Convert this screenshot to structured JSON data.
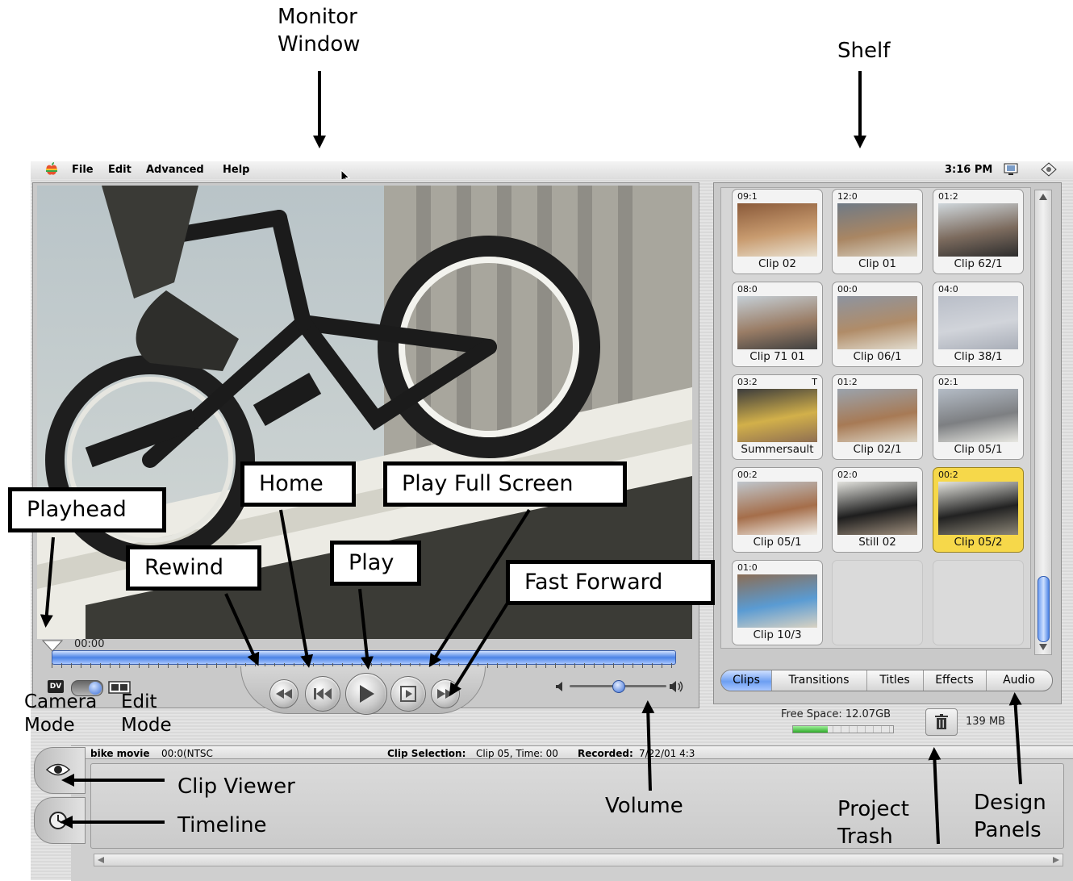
{
  "annotations": {
    "monitor_window": [
      "Monitor",
      "Window"
    ],
    "shelf": "Shelf",
    "playhead": "Playhead",
    "home": "Home",
    "play_full_screen": "Play Full Screen",
    "rewind": "Rewind",
    "play": "Play",
    "fast_forward": "Fast Forward",
    "camera_mode": [
      "Camera",
      "Mode"
    ],
    "edit_mode": [
      "Edit",
      "Mode"
    ],
    "clip_viewer": "Clip Viewer",
    "timeline": "Timeline",
    "volume": "Volume",
    "project_trash": [
      "Project",
      "Trash"
    ],
    "design_panels": [
      "Design",
      "Panels"
    ]
  },
  "menubar": {
    "items": [
      "File",
      "Edit",
      "Advanced",
      "Help"
    ],
    "clock": "3:16 PM"
  },
  "monitor": {
    "timecode": "00:00",
    "volume_level": 0.5
  },
  "shelf": {
    "clips": [
      {
        "time": "09:1",
        "name": "Clip 02",
        "selected": false
      },
      {
        "time": "12:0",
        "name": "Clip 01",
        "selected": false
      },
      {
        "time": "01:2",
        "name": "Clip 62/1",
        "selected": false
      },
      {
        "time": "08:0",
        "name": "Clip 71 01",
        "selected": false
      },
      {
        "time": "00:0",
        "name": "Clip 06/1",
        "selected": false
      },
      {
        "time": "04:0",
        "name": "Clip 38/1",
        "selected": false
      },
      {
        "time": "03:2",
        "flag": "T",
        "name": "Summersault",
        "selected": false
      },
      {
        "time": "01:2",
        "name": "Clip 02/1",
        "selected": false
      },
      {
        "time": "02:1",
        "name": "Clip 05/1",
        "selected": false
      },
      {
        "time": "00:2",
        "name": "Clip 05/1",
        "selected": false
      },
      {
        "time": "02:0",
        "name": "Still 02",
        "selected": false
      },
      {
        "time": "00:2",
        "name": "Clip 05/2",
        "selected": true
      },
      {
        "time": "01:0",
        "name": "Clip 10/3",
        "selected": false
      }
    ],
    "tabs": [
      "Clips",
      "Transitions",
      "Titles",
      "Effects",
      "Audio"
    ],
    "active_tab": "Clips"
  },
  "status": {
    "free_space": "Free Space: 12.07GB",
    "free_space_fraction": 0.35,
    "trash_size": "139 MB"
  },
  "timeline_info": {
    "project": "bike movie",
    "project_meta": "00:0(NTSC",
    "clip_selection_label": "Clip Selection:",
    "clip_selection_value": "Clip 05, Time: 00",
    "recorded_label": "Recorded:",
    "recorded_value": "7/22/01  4:3"
  }
}
